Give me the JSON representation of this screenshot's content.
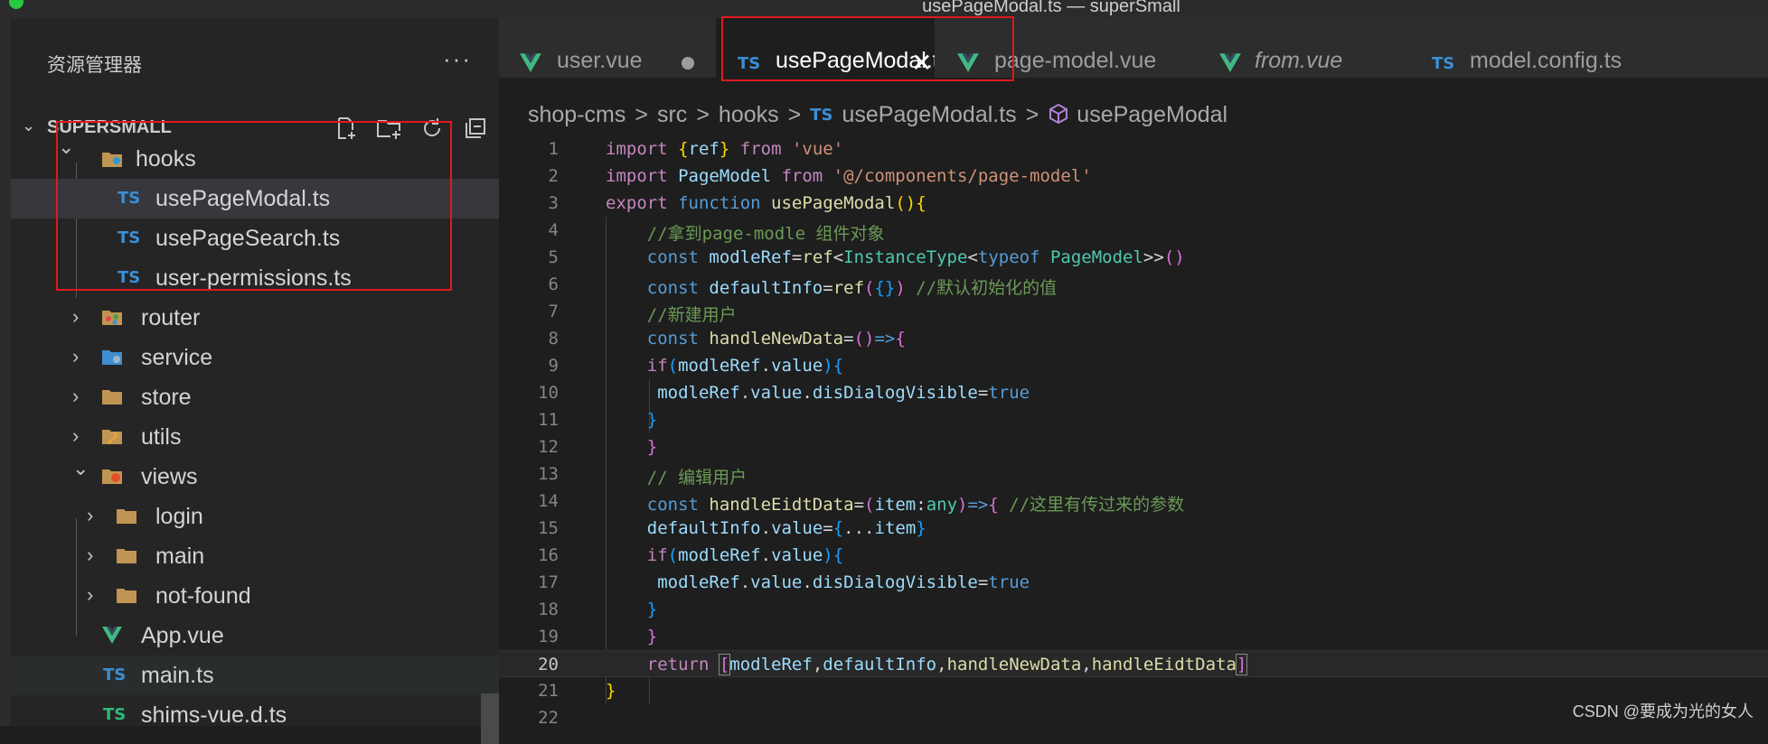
{
  "window": {
    "title": "usePageModal.ts — superSmall"
  },
  "sidebar": {
    "title": "资源管理器",
    "more": "···",
    "root": "SUPERSMALL",
    "items": [
      {
        "label": "hooks",
        "icon": "folder-hooks-icon",
        "expanded": true
      },
      {
        "label": "usePageModal.ts",
        "icon": "TS",
        "selected": true
      },
      {
        "label": "usePageSearch.ts",
        "icon": "TS"
      },
      {
        "label": "user-permissions.ts",
        "icon": "TS"
      },
      {
        "label": "router",
        "icon": "folder-router-icon"
      },
      {
        "label": "service",
        "icon": "folder-service-icon"
      },
      {
        "label": "store",
        "icon": "folder-icon"
      },
      {
        "label": "utils",
        "icon": "folder-utils-icon"
      },
      {
        "label": "views",
        "icon": "folder-views-icon",
        "expanded": true
      },
      {
        "label": "login",
        "icon": "folder-icon"
      },
      {
        "label": "main",
        "icon": "folder-icon"
      },
      {
        "label": "not-found",
        "icon": "folder-icon"
      },
      {
        "label": "App.vue",
        "icon": "vue-icon"
      },
      {
        "label": "main.ts",
        "icon": "TS"
      },
      {
        "label": "shims-vue.d.ts",
        "icon": "TS"
      }
    ]
  },
  "tabs": [
    {
      "label": "user.vue",
      "icon": "vue-icon",
      "modified": true
    },
    {
      "label": "usePageModal.ts",
      "icon": "TS",
      "active": true,
      "close": "✕"
    },
    {
      "label": "page-model.vue",
      "icon": "vue-icon"
    },
    {
      "label": "from.vue",
      "icon": "vue-icon",
      "italic": true
    },
    {
      "label": "model.config.ts",
      "icon": "TS"
    }
  ],
  "breadcrumb": {
    "parts": [
      "shop-cms",
      "src",
      "hooks"
    ],
    "file": "usePageModal.ts",
    "file_icon": "TS",
    "symbol": "usePageModal",
    "sep": ">"
  },
  "editor": {
    "current_line": 20,
    "line_numbers": [
      "1",
      "2",
      "3",
      "4",
      "5",
      "6",
      "7",
      "8",
      "9",
      "10",
      "11",
      "12",
      "13",
      "14",
      "15",
      "16",
      "17",
      "18",
      "19",
      "20",
      "21",
      "22"
    ],
    "lines": [
      "import {ref} from 'vue'",
      "import PageModel from '@/components/page-model'",
      "export function usePageModal(){",
      "    //拿到page-modle 组件对象",
      "    const modleRef=ref<InstanceType<typeof PageModel>>()",
      "    const defaultInfo=ref({}) //默认初始化的值",
      "    //新建用户",
      "    const handleNewData=()=>{",
      "    if(modleRef.value){",
      "     modleRef.value.disDialogVisible=true",
      "    }",
      "    }",
      "    // 编辑用户",
      "    const handleEidtData=(item:any)=>{ //这里有传过来的参数",
      "    defaultInfo.value={...item}",
      "    if(modleRef.value){",
      "     modleRef.value.disDialogVisible=true",
      "    }",
      "    }",
      "    return [modleRef,defaultInfo,handleNewData,handleEidtData]",
      "}",
      ""
    ]
  },
  "watermark": "CSDN @要成为光的女人",
  "colors": {
    "highlight_box": "#e0191f",
    "ts_blue": "#3b8fd6",
    "vue_green": "#41b883"
  }
}
